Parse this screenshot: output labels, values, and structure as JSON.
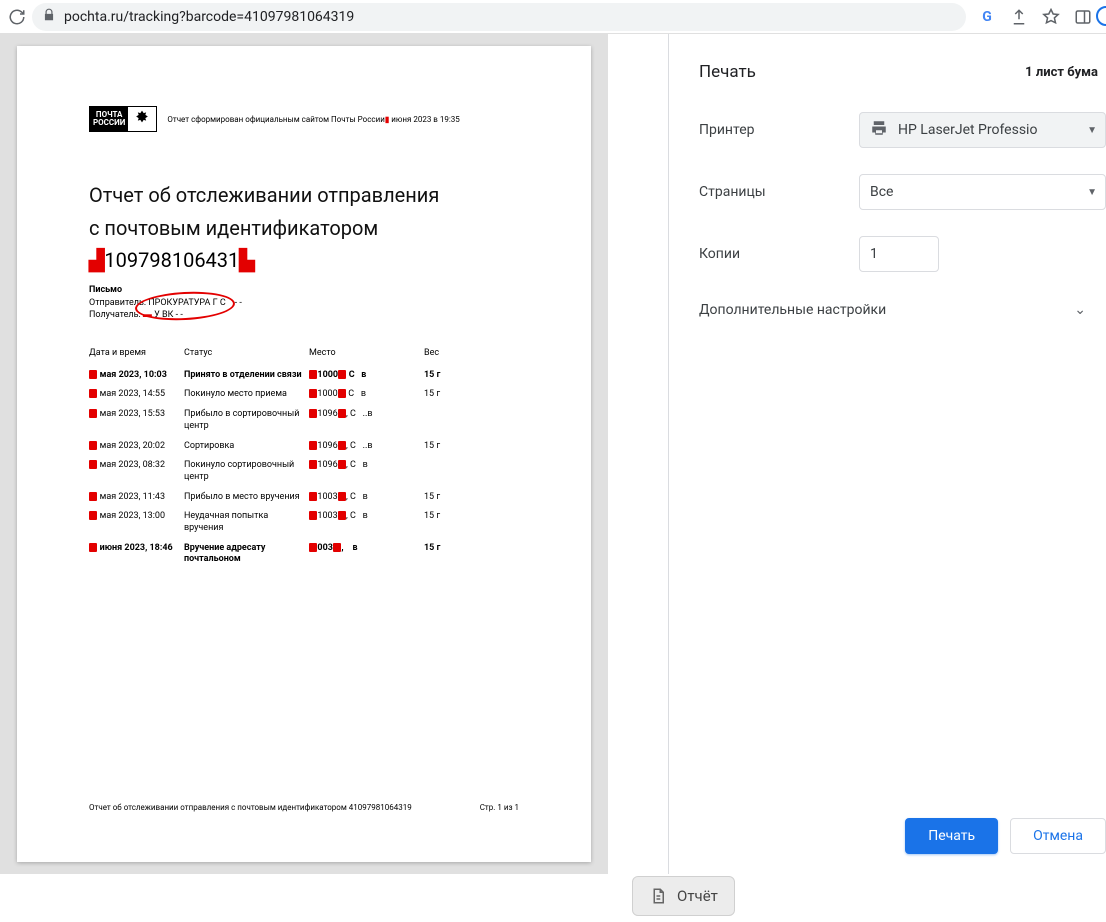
{
  "browser": {
    "url": "pochta.ru/tracking?barcode=41097981064319"
  },
  "document": {
    "logo_top": "ПОЧТА",
    "logo_bottom": "РОССИИ",
    "report_generated_prefix": "Отчет сформирован официальным сайтом Почты России",
    "report_generated_suffix": " июня 2023 в 19:35",
    "title_line1": "Отчет об отслеживании отправления",
    "title_line2": "с почтовым идентификатором",
    "barcode_mid": "109798106431",
    "meta_title": "Письмо",
    "sender_label": "Отправитель:",
    "sender_value": "ПРОКУРАТУРА Г С",
    "sender_dashes": "- -",
    "recipient_label": "Получатель:",
    "recipient_value": "У ВК - -",
    "table_headers": {
      "datetime": "Дата и время",
      "status": "Статус",
      "place": "Место",
      "weight": "Вес"
    },
    "rows": [
      {
        "date": " мая 2023, 10:03",
        "status": "Принято в отделении связи",
        "place_code": "1000",
        "place": " C",
        "place2": "в",
        "weight": "15 г",
        "bold": true
      },
      {
        "date": " мая 2023, 14:55",
        "status": "Покинуло место приема",
        "place_code": "1000",
        "place": " C",
        "place2": "в",
        "weight": "15 г"
      },
      {
        "date": " мая 2023, 15:53",
        "status": "Прибыло в сортировочный центр",
        "place_code": "1096",
        "place": ", C",
        "place2": "..в",
        "weight": ""
      },
      {
        "date": " мая 2023, 20:02",
        "status": "Сортировка",
        "place_code": "1096",
        "place": ", C",
        "place2": "..в",
        "weight": "15 г"
      },
      {
        "date": " мая 2023, 08:32",
        "status": "Покинуло сортировочный центр",
        "place_code": "1096",
        "place": ", C",
        "place2": "в",
        "weight": ""
      },
      {
        "date": " мая 2023, 11:43",
        "status": "Прибыло в место вручения",
        "place_code": "1003",
        "place": ", C",
        "place2": "в",
        "weight": "15 г"
      },
      {
        "date": " мая 2023, 13:00",
        "status": "Неудачная попытка вручения",
        "place_code": "1003",
        "place": ", C",
        "place2": "в",
        "weight": "15 г"
      },
      {
        "date": " июня 2023, 18:46",
        "status": "Вручение адресату почтальоном",
        "place_code": "003",
        "place": ", ",
        "place2": "в",
        "weight": "15 г",
        "bold": true
      }
    ],
    "footer_left": "Отчет об отслеживании отправления с почтовым идентификатором 41097981064319",
    "footer_right": "Стр. 1 из 1"
  },
  "print_panel": {
    "title": "Печать",
    "sheets": "1 лист бума",
    "printer_label": "Принтер",
    "printer_value": "HP LaserJet Professio",
    "pages_label": "Страницы",
    "pages_value": "Все",
    "copies_label": "Копии",
    "copies_value": "1",
    "more_label": "Дополнительные настройки",
    "print_btn": "Печать",
    "cancel_btn": "Отмена"
  },
  "bottom_tab": {
    "label": "Отчёт"
  }
}
